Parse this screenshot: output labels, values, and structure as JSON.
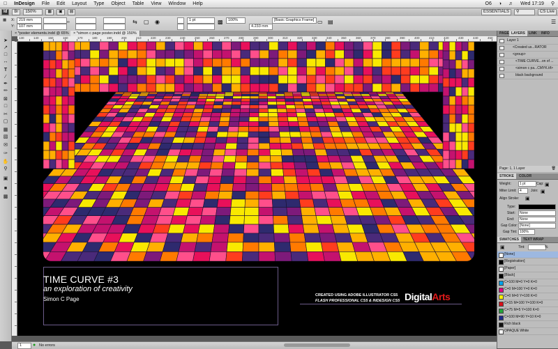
{
  "menubar": {
    "app": "InDesign",
    "items": [
      "File",
      "Edit",
      "Layout",
      "Type",
      "Object",
      "Table",
      "View",
      "Window",
      "Help"
    ],
    "right_badge": "O6",
    "clock": "Wed 17:19"
  },
  "appbar": {
    "zoom": "150%",
    "workspace": "ESSENTIALS",
    "cs_live": "CS Live"
  },
  "control": {
    "x_label": "X:",
    "x_value": "219 mm",
    "y_label": "Y:",
    "y_value": "107 mm",
    "stroke_weight": "1 pt",
    "percent": "100%",
    "size_value": "4.233 mm",
    "frame_style": "[Basic Graphics Frame]"
  },
  "tabs": [
    {
      "label": "*poster elements.indd @ 65%"
    },
    {
      "label": "*simon c page poster.indd @ 150%"
    }
  ],
  "ruler_numbers": [
    "130",
    "140",
    "150",
    "160",
    "170",
    "180",
    "190",
    "200",
    "210",
    "220",
    "230",
    "240",
    "250",
    "260",
    "270",
    "280",
    "290",
    "300",
    "310",
    "320",
    "330",
    "340",
    "350",
    "360",
    "370",
    "380",
    "390",
    "400",
    "410",
    "420",
    "430",
    "440",
    "450"
  ],
  "poster": {
    "title": "TIME CURVE #3",
    "subtitle": "an exploration of creativity",
    "author": "Simon C Page",
    "credit_line1": "CREATED USING ADOBE ILLUSTRATOR CS5",
    "credit_line2": "FLASH PROFESSIONAL CS5 & INDESIGN CS5",
    "logo_a": "Digital",
    "logo_b": "Arts",
    "palette": [
      "#f9e900",
      "#ffb000",
      "#ff7a00",
      "#ff3c1e",
      "#e8105a",
      "#c4126e",
      "#7d1a7a",
      "#4a2a7a",
      "#2e2a6e",
      "#ff4f8b"
    ]
  },
  "status": {
    "page": "1",
    "errors": "No errors"
  },
  "layers": {
    "tabs": [
      "PAGES",
      "LAYERS",
      "LINK",
      "INFO"
    ],
    "rows": [
      "Layer 1",
      "<Created us...RATOR",
      "<group>",
      "<TIME CURVE...on of ...",
      "<simon c pa...CMYK.tif>",
      "black background"
    ],
    "footer": "Page: 1, 1 Layer"
  },
  "stroke": {
    "tabs": [
      "STROKE",
      "COLOR"
    ],
    "weight_label": "Weight:",
    "weight_value": "1 pt",
    "cap_label": "Cap:",
    "miter_label": "Miter Limit:",
    "miter_value": "4",
    "join_label": "Join:",
    "align_label": "Align Stroke:",
    "type_label": "Type:",
    "start_label": "Start:",
    "start_value": "None",
    "end_label": "End:",
    "end_value": "None",
    "gap_color_label": "Gap Color:",
    "gap_color_value": "[None]",
    "gap_tint_label": "Gap Tint:",
    "gap_tint_value": "100%"
  },
  "swatches": {
    "tabs": [
      "SWATCHES",
      "TEXT WRAP"
    ],
    "tint_label": "Tint:",
    "tint_value": "%",
    "items": [
      {
        "name": "[None]",
        "color": "#ffffff"
      },
      {
        "name": "[Registration]",
        "color": "#000000"
      },
      {
        "name": "[Paper]",
        "color": "#ffffff"
      },
      {
        "name": "[Black]",
        "color": "#000000"
      },
      {
        "name": "C=100 M=0 Y=0 K=0",
        "color": "#00a0e9"
      },
      {
        "name": "C=0 M=100 Y=0 K=0",
        "color": "#e4007f"
      },
      {
        "name": "C=0 M=0 Y=100 K=0",
        "color": "#fff100"
      },
      {
        "name": "C=15 M=100 Y=100 K=0",
        "color": "#d7111b"
      },
      {
        "name": "C=75 M=5 Y=100 K=0",
        "color": "#23a33a"
      },
      {
        "name": "C=100 M=90 Y=10 K=0",
        "color": "#1d2a88"
      },
      {
        "name": "Rich black",
        "color": "#111111"
      },
      {
        "name": "OPAQUE White",
        "color": "#ffffff"
      }
    ]
  }
}
